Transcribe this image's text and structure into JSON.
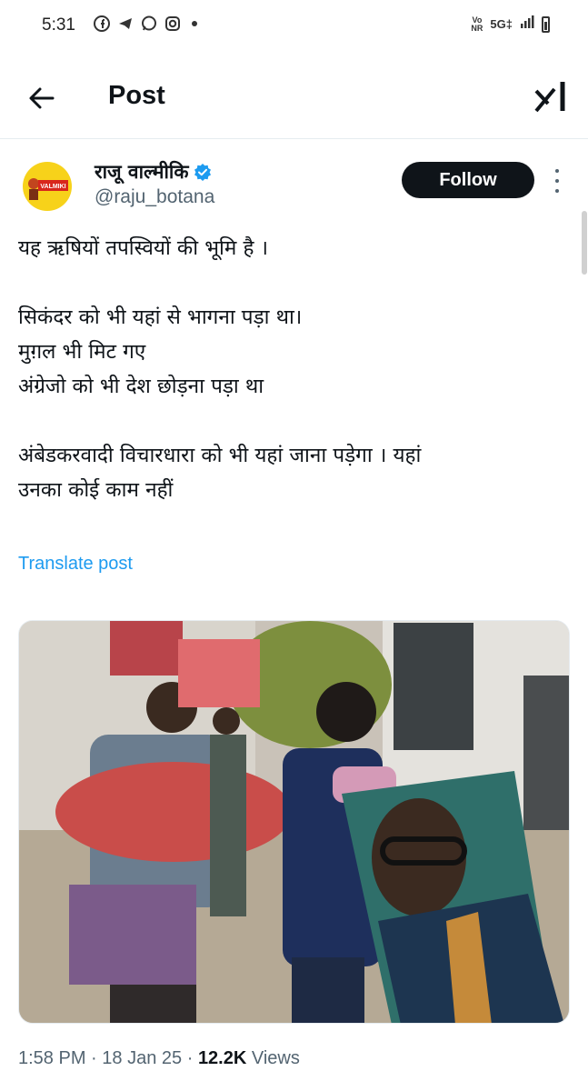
{
  "status_bar": {
    "time": "5:31",
    "apps": [
      "facebook-icon",
      "telegram-icon",
      "whatsapp-icon",
      "instagram-icon"
    ],
    "volte_top": "Vo",
    "volte_bottom": "NR",
    "network": "5G‡"
  },
  "header": {
    "title": "Post"
  },
  "author": {
    "name": "राजू वाल्मीकि",
    "handle": "@raju_botana",
    "avatar_label": "VALMIKI",
    "verified": true
  },
  "follow_label": "Follow",
  "post": {
    "lines": [
      "यह ऋषियों तपस्वियों की भूमि है ।",
      "सिकंदर को भी यहां से भागना पड़ा था।",
      "मुग़ल भी मिट गए",
      "अंग्रेजो को भी देश छोड़ना पड़ा था",
      "अंबेडकरवादी विचारधारा को भी यहां जाना पड़ेगा । यहां",
      "उनका कोई काम नहीं"
    ],
    "translate_label": "Translate post"
  },
  "meta": {
    "time": "1:58 PM",
    "date": "18 Jan 25",
    "views_count": "12.2K",
    "views_label": "Views",
    "separator": "·"
  },
  "colors": {
    "accent": "#1d9bf0",
    "text": "#0f1419",
    "secondary": "#536471",
    "follow_bg": "#0f1419"
  }
}
